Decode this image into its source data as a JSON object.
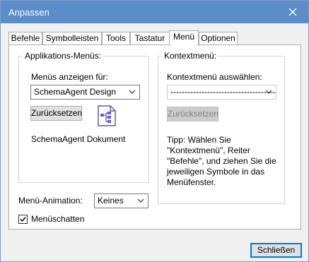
{
  "window": {
    "title": "Anpassen",
    "close_icon": "close-icon"
  },
  "tabs": [
    {
      "label": "Befehle"
    },
    {
      "label": "Symbolleisten"
    },
    {
      "label": "Tools"
    },
    {
      "label": "Tastatur"
    },
    {
      "label": "Menü",
      "active": true
    },
    {
      "label": "Optionen"
    }
  ],
  "app_menus": {
    "legend": "Applikations-Menüs:",
    "show_for_label": "Menüs anzeigen für:",
    "show_for_value": "SchemaAgent Design",
    "reset_label": "Zurücksetzen",
    "doc_icon": "schema-document-icon",
    "doc_caption": "SchemaAgent Dokument"
  },
  "context_menu": {
    "legend": "Kontextmenü:",
    "select_label": "Kontextmenü auswählen:",
    "select_value": "----------------------------------------",
    "reset_label": "Zurücksetzen",
    "tip": "Tipp: Wählen Sie \"Kontextmenü\", Reiter \"Befehle\", und ziehen Sie die jeweiligen Symbole in das Menüfenster."
  },
  "animation": {
    "label": "Menü-Animation:",
    "value": "Keines"
  },
  "shadow": {
    "label": "Menüschatten",
    "checked": true
  },
  "footer": {
    "close_label": "Schließen"
  },
  "colors": {
    "titlebar": "#5b8dc9",
    "accent": "#0078d7"
  }
}
